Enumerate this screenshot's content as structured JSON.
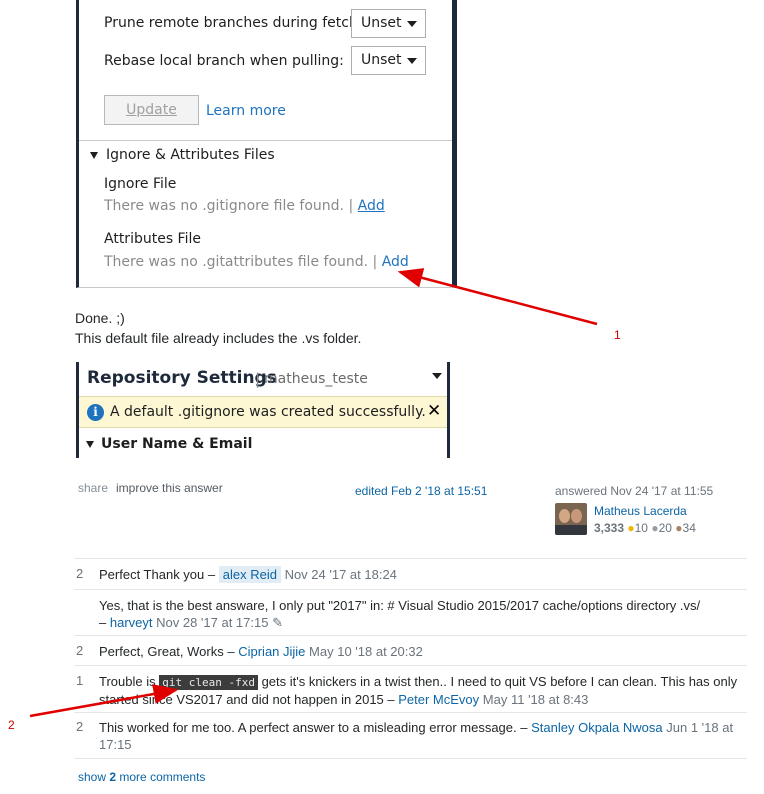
{
  "git_panel": {
    "prune_label": "Prune remote branches during fetch:",
    "prune_value": "Unset",
    "rebase_label": "Rebase local branch when pulling:",
    "rebase_value": "Unset",
    "update_button": "Update",
    "learn_more": "Learn more",
    "section_title": "Ignore & Attributes Files",
    "ignore_title": "Ignore File",
    "ignore_text": "There was no .gitignore file found. |",
    "ignore_add": "Add",
    "attributes_title": "Attributes File",
    "attributes_text": "There was no .gitattributes file found. |",
    "attributes_add": "Add"
  },
  "answer_text": {
    "line1": "Done. ;)",
    "line2": "This default file already includes the .vs folder."
  },
  "repo_panel": {
    "title": "Repository Settings",
    "separator": "|",
    "repo_name": "matheus_teste",
    "info_message": "A default .gitignore was created successfully.",
    "close_symbol": "✕",
    "section": "User Name & Email"
  },
  "answer_meta": {
    "share": "share",
    "improve": "improve this answer",
    "edited": "edited Feb 2 '18 at 15:51",
    "answered": "answered Nov 24 '17 at 11:55",
    "user_name": "Matheus Lacerda",
    "reputation": "3,333",
    "gold": "10",
    "silver": "20",
    "bronze": "34",
    "gold_color": "#f1b600",
    "silver_color": "#9a9c9f",
    "bronze_color": "#ab825f"
  },
  "comments": [
    {
      "score": "2",
      "text": "Perfect Thank you –",
      "user": "alex Reid",
      "date": "Nov 24 '17 at 18:24"
    },
    {
      "score": "",
      "text": "Yes, that is the best answare, I only put \"2017\" in: # Visual Studio 2015/2017 cache/options directory .vs/",
      "dash": "–",
      "user": "harveyt",
      "date": "Nov 28 '17 at 17:15"
    },
    {
      "score": "2",
      "text": "Perfect, Great, Works –",
      "user": "Ciprian Jijie",
      "date": "May 10 '18 at 20:32"
    },
    {
      "score": "1",
      "text_pre": "Trouble is",
      "code": "git clean -fxd",
      "text_post": "gets it's knickers in a twist then.. I need to quit VS before I can clean. This has only started since VS2017 and did not happen in 2015 –",
      "user": "Peter McEvoy",
      "date": "May 11 '18 at 8:43"
    },
    {
      "score": "2",
      "text": "This worked for me too. A perfect answer to a misleading error message. –",
      "user": "Stanley Okpala Nwosa",
      "date": "Jun 1 '18 at 17:15"
    }
  ],
  "show_more": {
    "prefix": "show",
    "count": "2",
    "suffix": "more comments"
  },
  "annotations": {
    "one": "1",
    "two": "2"
  }
}
